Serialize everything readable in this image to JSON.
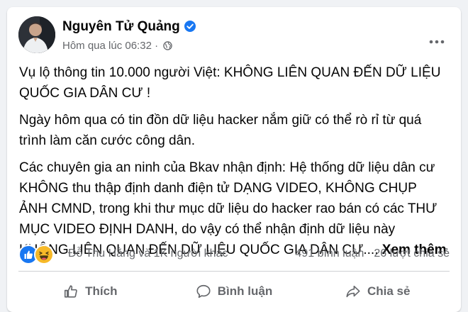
{
  "post": {
    "author": "Nguyên Tử Quảng",
    "timestamp": "Hôm qua lúc 06:32",
    "audience_icon": "globe-icon",
    "verified_icon": "verified-badge-icon",
    "more_icon": "more-options-icon",
    "paragraphs": [
      "Vụ lộ thông tin 10.000 người Việt: KHÔNG LIÊN QUAN ĐẾN DỮ LIỆU QUỐC GIA DÂN CƯ !",
      "Ngày hôm qua có tin đồn dữ liệu hacker nắm giữ có thể rò rỉ từ quá trình làm căn cước công dân.",
      "Các chuyên gia an ninh của Bkav nhận định: Hệ thống dữ liệu dân cư KHÔNG thu thập định danh điện tử DẠNG VIDEO, KHÔNG CHỤP ẢNH CMND, trong khi thư mục dữ liệu do hacker rao bán có các THƯ MỤC VIDEO ĐỊNH DANH, do vậy có thể nhận định dữ liệu này KHÔNG LIÊN QUAN ĐẾN DỮ LIỆU QUỐC GIA DÂN CƯ...."
    ],
    "see_more": "Xem thêm"
  },
  "stats": {
    "reaction_icons": [
      "like-icon",
      "haha-icon"
    ],
    "reactors": "Đỗ Thu Hằng và 1K người khác",
    "comments": "491 bình luận",
    "shares": "26 lượt chia sẻ"
  },
  "actions": [
    {
      "label": "Thích",
      "icon": "thumbs-up-icon"
    },
    {
      "label": "Bình luận",
      "icon": "comment-icon"
    },
    {
      "label": "Chia sẻ",
      "icon": "share-icon"
    }
  ],
  "colors": {
    "text_primary": "#050505",
    "text_secondary": "#65676b",
    "verified_blue": "#1877f2",
    "like_blue": "#1877f2",
    "haha_yellow": "#f7b928",
    "divider": "#ced0d4",
    "background": "#f0f2f5"
  }
}
